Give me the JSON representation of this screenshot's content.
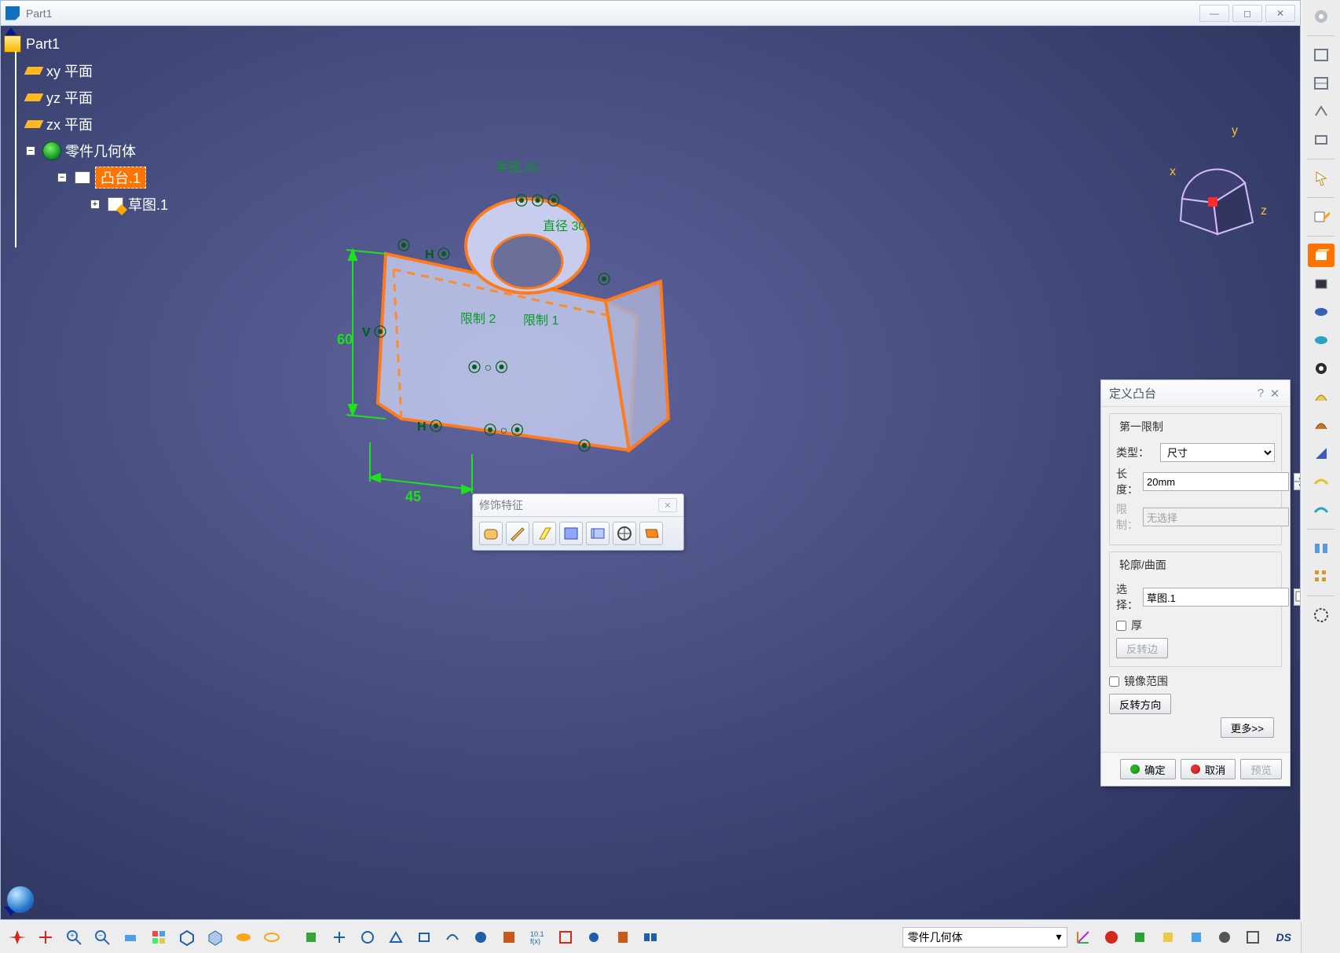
{
  "window": {
    "title": "Part1"
  },
  "tree": {
    "root": "Part1",
    "planes": [
      "xy 平面",
      "yz 平面",
      "zx 平面"
    ],
    "body": "零件几何体",
    "pad": "凸台.1",
    "sketch": "草图.1"
  },
  "compass": {
    "x": "x",
    "y": "y",
    "z": "z"
  },
  "annotations": {
    "radius_label": "半径 25",
    "diameter_label": "直径 30",
    "limit1": "限制 1",
    "limit2": "限制 2",
    "dim60": "60",
    "dim45": "45",
    "sym_H": "H",
    "sym_V": "V"
  },
  "float_toolbar": {
    "title": "修饰特征"
  },
  "dialog": {
    "title": "定义凸台",
    "group1": "第一限制",
    "type_label": "类型：",
    "type_value": "尺寸",
    "length_label": "长度：",
    "length_value": "20mm",
    "limit_label": "限制：",
    "limit_value": "无选择",
    "group2": "轮廓/曲面",
    "select_label": "选择：",
    "select_value": "草图.1",
    "thick_label": "厚",
    "reverse_side": "反转边",
    "mirror_label": "镜像范围",
    "reverse_dir": "反转方向",
    "more": "更多>>",
    "ok": "确定",
    "cancel": "取消",
    "preview": "预览"
  },
  "bottom": {
    "combo": "零件几何体"
  }
}
